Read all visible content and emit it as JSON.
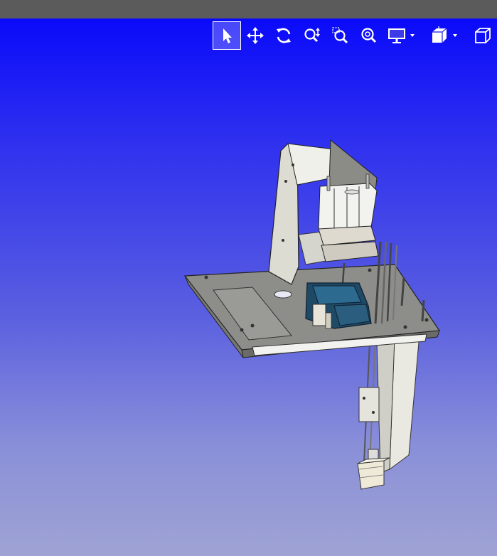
{
  "window": {
    "titlebar_color": "#5b5b5b"
  },
  "viewport": {
    "background_top": "#0a0afa",
    "background_bottom": "#9fa3d3",
    "model_name": "3d-machine-assembly"
  },
  "toolbar": {
    "buttons": [
      {
        "name": "select-tool",
        "icon": "pointer-arrow-icon",
        "active": true
      },
      {
        "name": "pan-tool",
        "icon": "move-arrows-icon",
        "active": false
      },
      {
        "name": "rotate-tool",
        "icon": "rotate-icon",
        "active": false
      },
      {
        "name": "zoom-tool",
        "icon": "zoom-updown-icon",
        "active": false
      },
      {
        "name": "zoom-box-tool",
        "icon": "zoom-window-icon",
        "active": false
      },
      {
        "name": "zoom-fit-tool",
        "icon": "zoom-fit-icon",
        "active": false
      },
      {
        "name": "display-mode-dropdown",
        "icon": "monitor-icon",
        "active": false
      },
      {
        "name": "view-cube-dropdown",
        "icon": "cube-views-icon",
        "active": false
      },
      {
        "name": "iso-view-button",
        "icon": "iso-cube-icon",
        "active": false
      }
    ]
  }
}
